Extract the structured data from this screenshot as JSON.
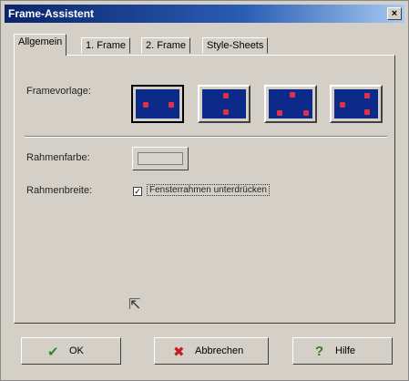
{
  "window": {
    "title": "Frame-Assistent",
    "close_symbol": "×"
  },
  "tabs": [
    {
      "label": "Allgemein",
      "active": true
    },
    {
      "label": "1. Frame",
      "active": false
    },
    {
      "label": "2. Frame",
      "active": false
    },
    {
      "label": "Style-Sheets",
      "active": false
    }
  ],
  "frame_template": {
    "label": "Framevorlage:",
    "options": [
      {
        "name": "two-columns",
        "selected": true
      },
      {
        "name": "two-rows",
        "selected": false
      },
      {
        "name": "top-row-two-bottom",
        "selected": false
      },
      {
        "name": "left-column-two-right",
        "selected": false
      }
    ],
    "thumb_color": "#0b2a8a",
    "dot_color": "#e0304a"
  },
  "frame_color": {
    "label": "Rahmenfarbe:"
  },
  "frame_width": {
    "label": "Rahmenbreite:",
    "checkbox_label": "Fensterrahmen unterdrücken",
    "checked": true,
    "check_symbol": "✓"
  },
  "cursor_symbol": "⇱",
  "buttons": [
    {
      "label": "OK",
      "icon": "check-icon",
      "glyph": "✔",
      "color": "#2f8a2f"
    },
    {
      "label": "Abbrechen",
      "icon": "cross-icon",
      "glyph": "✖",
      "color": "#c02020"
    },
    {
      "label": "Hilfe",
      "icon": "help-icon",
      "glyph": "?",
      "color": "#3a7a2a"
    }
  ]
}
